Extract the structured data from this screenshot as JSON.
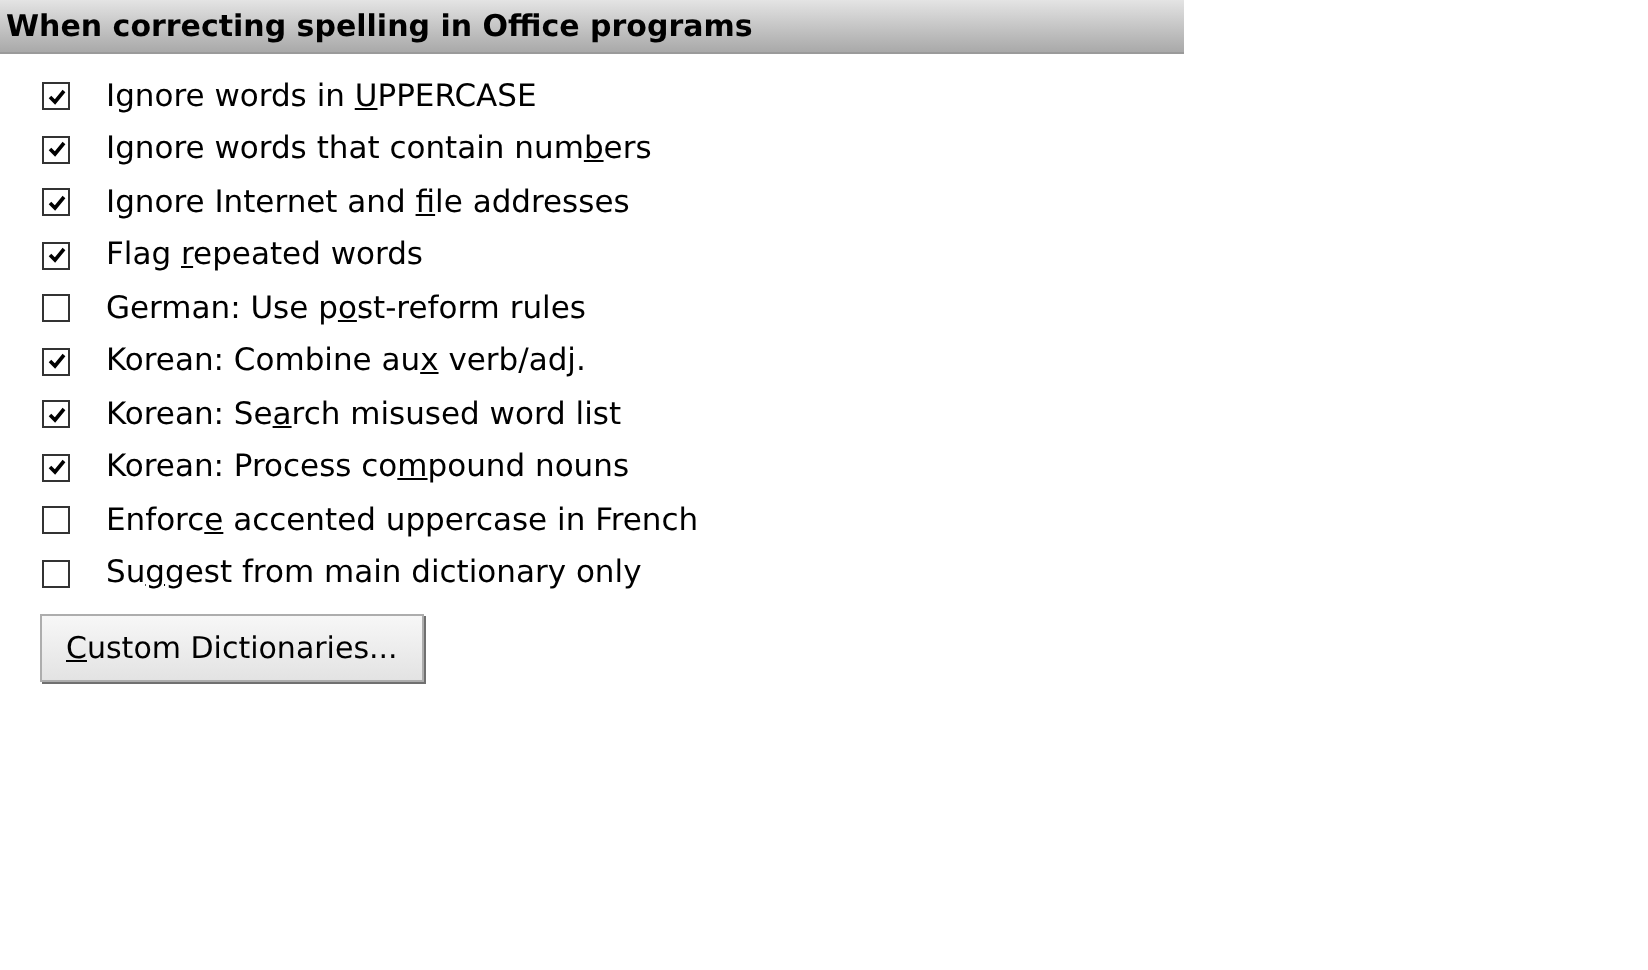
{
  "section": {
    "title": "When correcting spelling in Office programs"
  },
  "options": [
    {
      "text_before": "Ignore words in ",
      "access_key": "U",
      "text_after": "PPERCASE",
      "checked": true
    },
    {
      "text_before": "Ignore words that contain num",
      "access_key": "b",
      "text_after": "ers",
      "checked": true
    },
    {
      "text_before": "Ignore Internet and ",
      "access_key": "f",
      "text_after": "ile addresses",
      "checked": true
    },
    {
      "text_before": "Flag ",
      "access_key": "r",
      "text_after": "epeated words",
      "checked": true
    },
    {
      "text_before": "German: Use p",
      "access_key": "o",
      "text_after": "st-reform rules",
      "checked": false
    },
    {
      "text_before": "Korean: Combine au",
      "access_key": "x",
      "text_after": " verb/adj.",
      "checked": true
    },
    {
      "text_before": "Korean: Se",
      "access_key": "a",
      "text_after": "rch misused word list",
      "checked": true
    },
    {
      "text_before": "Korean: Process co",
      "access_key": "m",
      "text_after": "pound nouns",
      "checked": true
    },
    {
      "text_before": "Enforc",
      "access_key": "e",
      "text_after": " accented uppercase in French",
      "checked": false
    },
    {
      "text_before": "Su",
      "access_key": "g",
      "text_after": "gest from main dictionary only",
      "checked": false
    }
  ],
  "button": {
    "access_key": "C",
    "text_after": "ustom Dictionaries..."
  }
}
